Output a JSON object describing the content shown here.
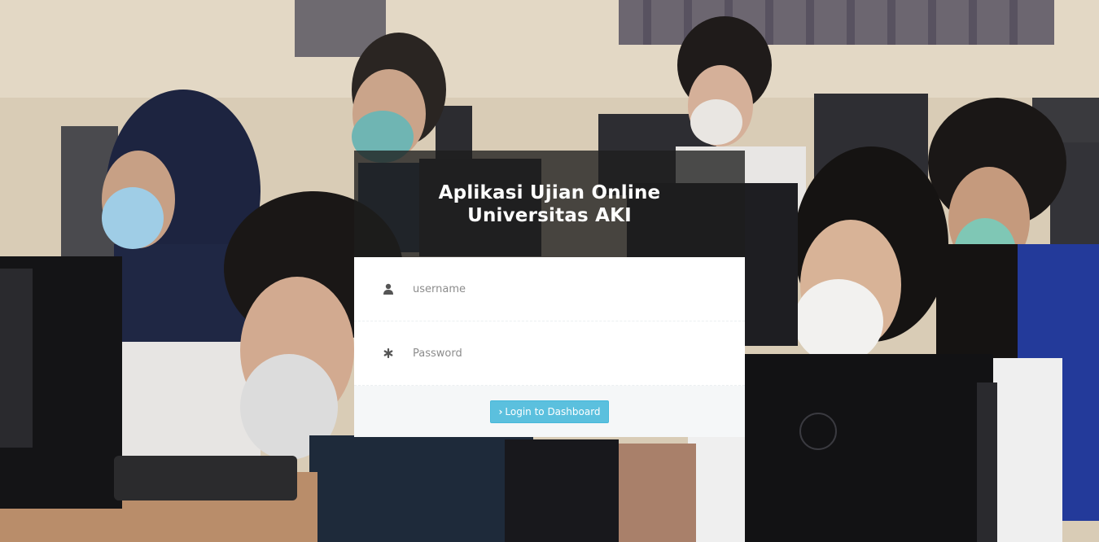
{
  "header": {
    "title_line1": "Aplikasi Ujian Online",
    "title_line2": "Universitas AKI"
  },
  "form": {
    "username_placeholder": "username",
    "password_placeholder": "Password",
    "username_icon": "user-icon",
    "password_icon": "asterisk-icon"
  },
  "footer": {
    "login_button_label": "Login to Dashboard",
    "login_button_icon": "chevron-right-icon"
  },
  "colors": {
    "accent": "#5bc0de",
    "header_overlay": "#1e1e1e"
  }
}
